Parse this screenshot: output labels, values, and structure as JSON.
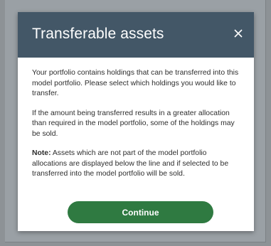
{
  "modal": {
    "title": "Transferable assets",
    "close_icon": "close-icon",
    "paragraph_1": "Your portfolio contains holdings that can be transferred into this model portfolio. Please select which holdings you would like to transfer.",
    "paragraph_2": "If the amount being transferred results in a greater allocation than required in the model portfolio, some of the holdings may be sold.",
    "note_label": "Note:",
    "note_text": " Assets which are not part of the model portfolio allocations are displayed below the line and if selected to be transferred into the model portfolio will be sold.",
    "continue_label": "Continue"
  },
  "colors": {
    "header_bg": "#435767",
    "button_bg": "#2f7a41",
    "backdrop": "#8d9296"
  }
}
